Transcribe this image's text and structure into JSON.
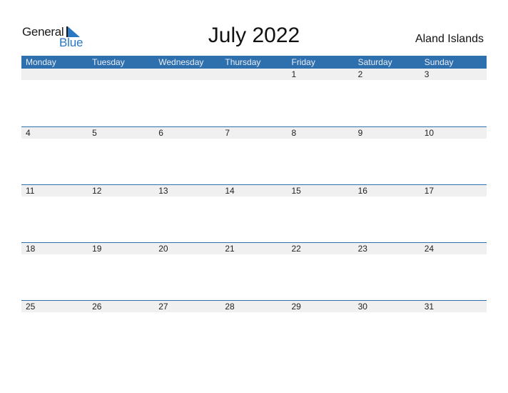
{
  "logo": {
    "word1": "General",
    "word2": "Blue"
  },
  "title": "July 2022",
  "region": "Aland Islands",
  "colors": {
    "accent": "#2e6fae",
    "row_bg": "#f0f0f0"
  },
  "weekdays": [
    "Monday",
    "Tuesday",
    "Wednesday",
    "Thursday",
    "Friday",
    "Saturday",
    "Sunday"
  ],
  "weeks": [
    [
      "",
      "",
      "",
      "",
      "1",
      "2",
      "3"
    ],
    [
      "4",
      "5",
      "6",
      "7",
      "8",
      "9",
      "10"
    ],
    [
      "11",
      "12",
      "13",
      "14",
      "15",
      "16",
      "17"
    ],
    [
      "18",
      "19",
      "20",
      "21",
      "22",
      "23",
      "24"
    ],
    [
      "25",
      "26",
      "27",
      "28",
      "29",
      "30",
      "31"
    ]
  ]
}
